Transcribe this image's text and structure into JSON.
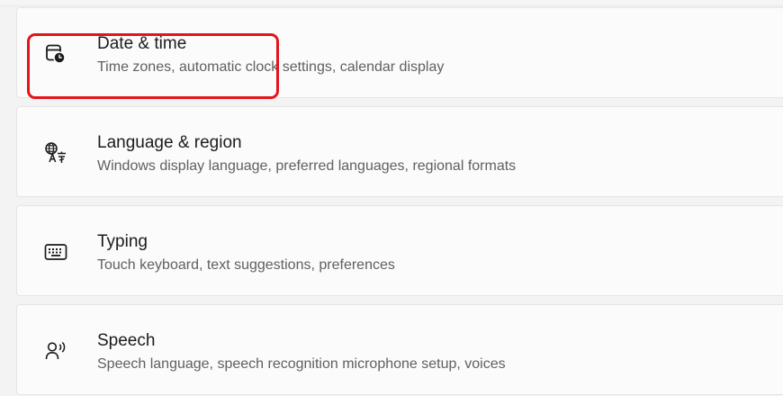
{
  "settings_items": [
    {
      "title": "Date & time",
      "description": "Time zones, automatic clock settings, calendar display",
      "icon": "calendar-clock-icon"
    },
    {
      "title": "Language & region",
      "description": "Windows display language, preferred languages, regional formats",
      "icon": "language-icon"
    },
    {
      "title": "Typing",
      "description": "Touch keyboard, text suggestions, preferences",
      "icon": "keyboard-icon"
    },
    {
      "title": "Speech",
      "description": "Speech language, speech recognition microphone setup, voices",
      "icon": "speech-icon"
    }
  ],
  "colors": {
    "page_background": "#f3f3f3",
    "card_background": "#fbfbfb",
    "highlight_outline": "#e4141b",
    "title_text": "#1b1b1b",
    "description_text": "#606060"
  }
}
